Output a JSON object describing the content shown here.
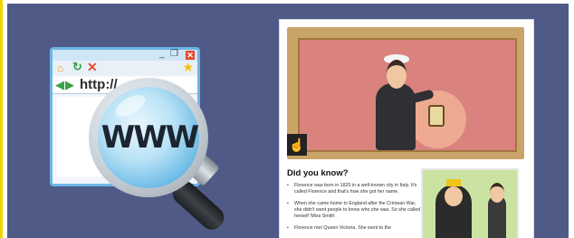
{
  "browser": {
    "url_text": "http://",
    "icons": [
      "home-icon",
      "refresh-icon",
      "stop-icon",
      "star-icon",
      "back-arrow-icon",
      "forward-arrow-icon",
      "minimize-icon",
      "maximize-icon",
      "close-icon"
    ],
    "minimize_glyph": "_",
    "maximize_glyph": "❐",
    "close_glyph": "✕"
  },
  "magnifier": {
    "label": "WWW"
  },
  "webpage": {
    "heading": "Did you know?",
    "facts": [
      "Florence was born in 1820 in a well-known city in Italy. It's called Florence and that's how she got her name.",
      "When she came home to England after the Crimean War, she didn't want people to know who she was. So she called herself 'Miss Smith'.",
      "Florence met Queen Victoria. She went to the"
    ],
    "interaction_icon": "hand-pointer-icon"
  },
  "colors": {
    "background": "#4f5a86",
    "painting": "#d9827e",
    "frame": "#c9a468",
    "lens_blue": "#5fb4e3"
  }
}
